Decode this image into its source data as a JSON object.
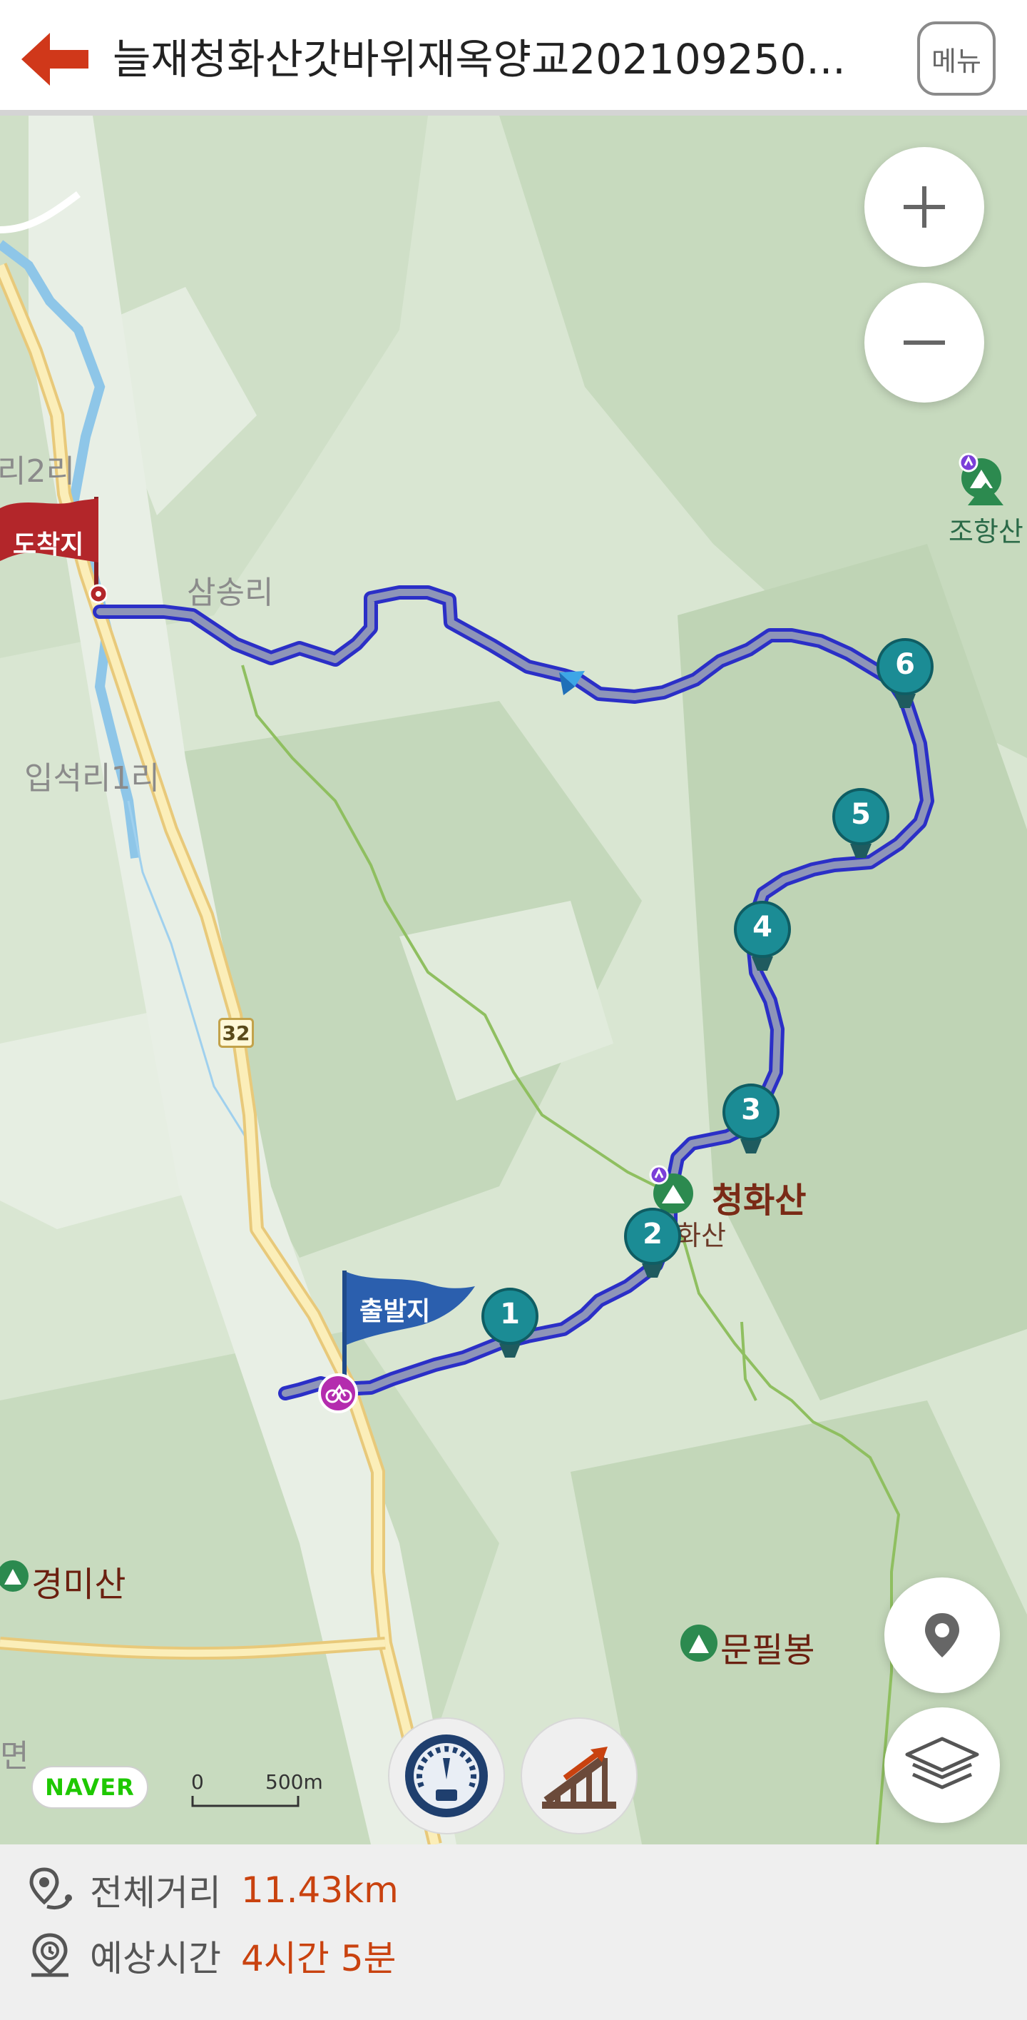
{
  "header": {
    "title": "늘재청화산갓바위재옥양교202109250...",
    "menu_label": "메뉴"
  },
  "map": {
    "village_labels": [
      "리2리",
      "삼송리",
      "입석리1리",
      "면"
    ],
    "peak_labels": {
      "joang": "조항산",
      "cheonghwa": "청화산",
      "cheonghwa_small": "화산",
      "gyeongmi": "경미산",
      "munpil": "문필봉"
    },
    "flags": {
      "start": "출발지",
      "end": "도착지"
    },
    "waypoints": [
      "1",
      "2",
      "3",
      "4",
      "5",
      "6"
    ],
    "route_number": "32",
    "naver_logo": "NAVER",
    "scale": {
      "left": "0",
      "right": "500m"
    },
    "icons": [
      "back-arrow-icon",
      "zoom-in-icon",
      "zoom-out-icon",
      "location-pin-icon",
      "layers-icon",
      "speedometer-icon",
      "elevation-icon",
      "route-distance-icon",
      "clock-icon"
    ],
    "colors": {
      "route": "#2b2fc7",
      "waypoint": "#1b8c95",
      "start_flag": "#2b5fae",
      "end_flag": "#b3262a",
      "accent": "#c9420f"
    }
  },
  "summary": {
    "distance_label": "전체거리",
    "distance_value": "11.43km",
    "time_label": "예상시간",
    "time_value": "4시간 5분"
  }
}
